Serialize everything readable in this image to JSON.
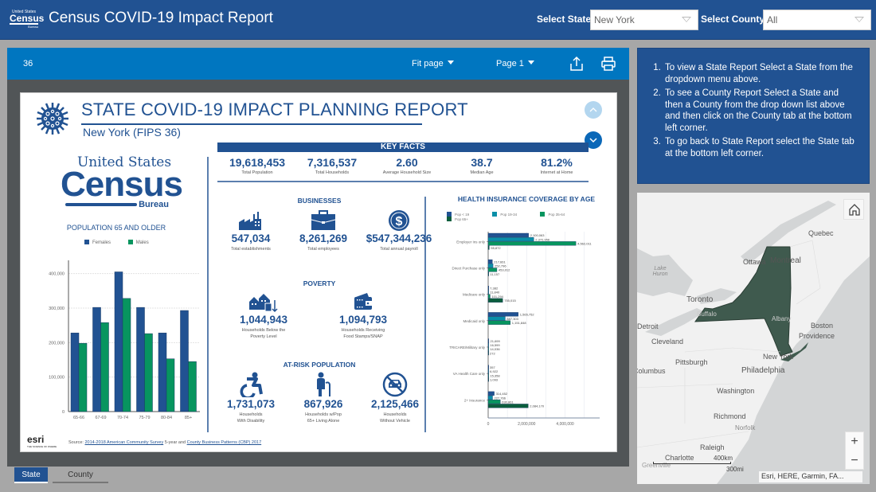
{
  "header": {
    "logo": {
      "line1": "United States",
      "line2": "Census",
      "line3": "Bureau"
    },
    "title": "Census COVID-19 Impact Report",
    "state_label": "Select State:",
    "state_value": "New York",
    "county_label": "Select County:",
    "county_value": "All"
  },
  "viewer": {
    "page_id": "36",
    "fit_label": "Fit page",
    "page_label": "Page 1",
    "share_icon": "share-icon",
    "print_icon": "print-icon"
  },
  "report": {
    "title": "STATE COVID-19 IMPACT PLANNING REPORT",
    "subtitle": "New York  (FIPS 36)",
    "census_logo": {
      "us": "United States",
      "census": "Census",
      "bureau": "Bureau"
    },
    "key_facts": {
      "title": "KEY FACTS",
      "items": [
        {
          "value": "19,618,453",
          "label": "Total Population"
        },
        {
          "value": "7,316,537",
          "label": "Total Households"
        },
        {
          "value": "2.60",
          "label": "Average Household Size"
        },
        {
          "value": "38.7",
          "label": "Median Age"
        },
        {
          "value": "81.2%",
          "label": "Internet at Home"
        }
      ]
    },
    "businesses": {
      "title": "BUSINESSES",
      "items": [
        {
          "icon": "factory-icon",
          "value": "547,034",
          "label": "Total establishments"
        },
        {
          "icon": "briefcase-icon",
          "value": "8,261,269",
          "label": "Total employees"
        },
        {
          "icon": "dollar-icon",
          "value": "$547,344,236",
          "label": "Total annual payroll"
        }
      ]
    },
    "poverty": {
      "title": "POVERTY",
      "items": [
        {
          "icon": "houses-down-icon",
          "value": "1,044,943",
          "label1": "Households Below the",
          "label2": "Poverty Level"
        },
        {
          "icon": "wallet-icon",
          "value": "1,094,793",
          "label1": "Households Receiving",
          "label2": "Food Stamps/SNAP"
        }
      ]
    },
    "at_risk": {
      "title": "AT-RISK POPULATION",
      "items": [
        {
          "icon": "wheelchair-icon",
          "value": "1,731,073",
          "label1": "Households",
          "label2": "With Disability"
        },
        {
          "icon": "elderly-icon",
          "value": "867,926",
          "label1": "Households w/Pop",
          "label2": "65+ Living Alone"
        },
        {
          "icon": "no-car-icon",
          "value": "2,125,466",
          "label1": "Households",
          "label2": "Without Vehicle"
        }
      ]
    },
    "source": {
      "prefix": "Source: ",
      "link1": "2014-2018 American Community Survey",
      "middle": " 5-year and ",
      "link2": "County Business Patterns (CBP) 2017"
    },
    "esri": {
      "name": "esri",
      "tagline": "THE SCIENCE OF WHERE"
    }
  },
  "chart_data": [
    {
      "type": "bar",
      "title": "POPULATION 65 AND OLDER",
      "categories": [
        "65-66",
        "67-69",
        "70-74",
        "75-79",
        "80-84",
        "85+"
      ],
      "series": [
        {
          "name": "Females",
          "color": "#215292",
          "values": [
            228000,
            302000,
            405000,
            302000,
            228000,
            293000
          ]
        },
        {
          "name": "Males",
          "color": "#07955f",
          "values": [
            198000,
            258000,
            328000,
            226000,
            153000,
            145000
          ]
        }
      ],
      "ylim": [
        0,
        420000
      ],
      "yticks": [
        0,
        100000,
        200000,
        300000,
        400000
      ],
      "ytick_labels": [
        "0",
        "100,000",
        "200,000",
        "300,000",
        "400,000"
      ],
      "legend": "top"
    },
    {
      "type": "bar",
      "orientation": "horizontal",
      "title": "HEALTH INSURANCE COVERAGE BY AGE",
      "categories": [
        "Employer Ins only",
        "Direct Purchase only",
        "Medicare only",
        "Medicaid only",
        "TRICARE/Military only",
        "VA Health Care only",
        "2+ Insurance"
      ],
      "series": [
        {
          "name": "Pop < 19",
          "color": "#215292",
          "values": [
            2100063,
            217661,
            7382,
            1565752,
            21699,
            357,
            314452
          ],
          "labels": [
            "2,100,063",
            "217,661",
            "7,382",
            "1,565,752",
            "21,699",
            "357",
            "314,452"
          ]
        },
        {
          "name": "Pop 19-34",
          "color": "#0a8fa8",
          "values": [
            2372956,
            252796,
            11840,
            887303,
            16599,
            6922,
            227766
          ],
          "labels": [
            "2,372,956",
            "252,796",
            "11,840",
            "887,303",
            "16,599",
            "6,922",
            "227,766"
          ]
        },
        {
          "name": "Pop 35-64",
          "color": "#07955f",
          "values": [
            4562011,
            453012,
            101294,
            1151848,
            14036,
            15358,
            630861
          ],
          "labels": [
            "4,562,011",
            "453,012",
            "101,294",
            "1,151,848",
            "14,036",
            "15,358",
            "630,861"
          ]
        },
        {
          "name": "Pop 65+",
          "color": "#0b5e3d",
          "values": [
            55872,
            11157,
            755015,
            0,
            272,
            1093,
            2084170
          ],
          "labels": [
            "55,872",
            "11,157",
            "755,015",
            "",
            "272",
            "1,093",
            "2,084,170"
          ]
        }
      ],
      "xlim": [
        0,
        5800000
      ],
      "xticks": [
        0,
        2000000,
        4000000
      ],
      "xtick_labels": [
        "0",
        "2,000,000",
        "4,000,000"
      ],
      "legend": "top"
    }
  ],
  "info": {
    "steps": [
      "To view a State Report Select a State from the dropdown menu above.",
      "To see a County Report Select a State and then a County from the drop down list above and then click on the County tab at the bottom left corner.",
      "To go back to State Report select the State tab at the bottom left corner."
    ]
  },
  "map": {
    "labels": [
      "Quebec",
      "Ottawa",
      "Montreal",
      "Lake Huron",
      "Toronto",
      "Buffalo",
      "Detroit",
      "Albany",
      "Boston",
      "Providence",
      "Cleveland",
      "New York",
      "Pittsburgh",
      "Columbus",
      "Philadelphia",
      "Washington",
      "Richmond",
      "Norfolk",
      "Raleigh",
      "Charlotte",
      "Greenville"
    ],
    "scale_km": "400km",
    "scale_mi": "300mi",
    "attribution": "Esri, HERE, Garmin, FA...",
    "highlight_color": "#3f5a4e",
    "zoom_in": "+",
    "zoom_out": "−"
  },
  "tabs": {
    "state": "State",
    "county": "County"
  }
}
